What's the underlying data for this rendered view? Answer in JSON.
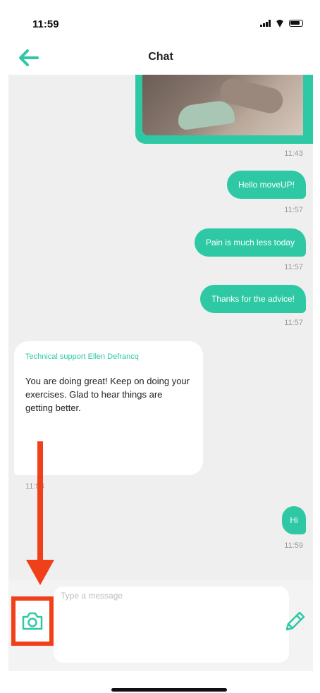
{
  "status_bar": {
    "time": "11:59"
  },
  "header": {
    "title": "Chat"
  },
  "messages": {
    "image_time": "11:43",
    "out": [
      {
        "text": "Hello moveUP!",
        "time": "11:57"
      },
      {
        "text": "Pain is much less today",
        "time": "11:57"
      },
      {
        "text": "Thanks for the advice!",
        "time": "11:57"
      }
    ],
    "incoming": {
      "sender": "Technical support Ellen Defrancq",
      "text": "You are doing great! Keep on doing your exercises. Glad to hear things are getting better.",
      "time": "11:58"
    },
    "last_out": {
      "text": "Hi",
      "time": "11:59"
    }
  },
  "composer": {
    "placeholder": "Type a message"
  },
  "colors": {
    "accent": "#2ec9a4",
    "annotation": "#f0401a"
  }
}
